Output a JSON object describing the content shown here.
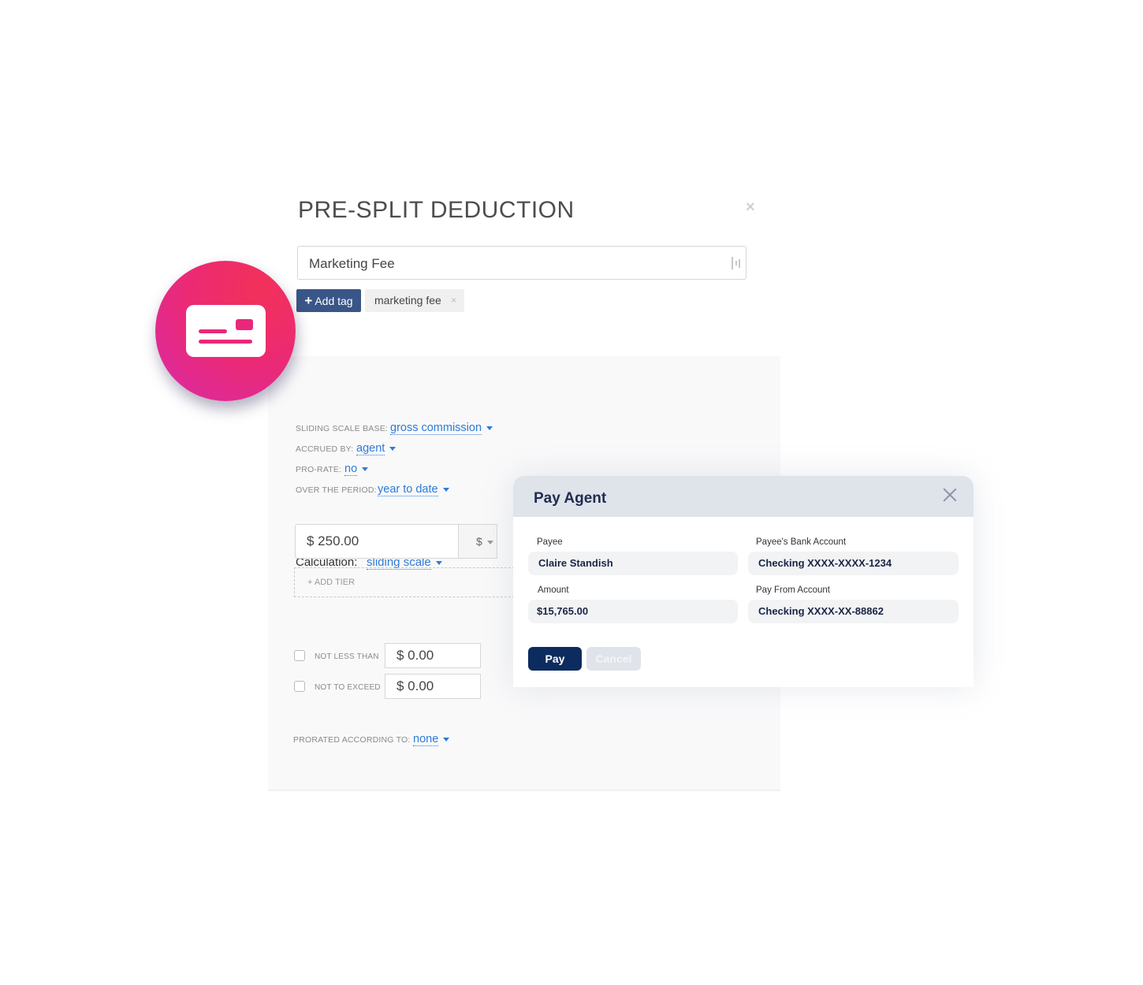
{
  "deduction": {
    "title": "PRE-SPLIT DEDUCTION",
    "close_glyph": "×",
    "name_value": "Marketing Fee",
    "add_tag_label": "Add tag",
    "add_tag_glyph": "+",
    "tag": "marketing fee",
    "tag_remove_glyph": "×",
    "calculation_label": "Calculation:",
    "calculation_value": "sliding scale",
    "options": [
      {
        "label": "SLIDING SCALE BASE:",
        "value": "gross commission"
      },
      {
        "label": "ACCRUED BY:",
        "value": "agent"
      },
      {
        "label": "PRO-RATE:",
        "value": "no"
      },
      {
        "label": "OVER THE PERIOD:",
        "value": "year to date"
      }
    ],
    "amount_value": "$ 250.00",
    "unit_value": "$",
    "add_tier_label": "+ ADD TIER",
    "not_less_than_label": "NOT LESS THAN",
    "not_less_than_value": "$ 0.00",
    "not_less_than_checked": false,
    "not_to_exceed_label": "NOT TO EXCEED",
    "not_to_exceed_value": "$ 0.00",
    "not_to_exceed_checked": false,
    "prorated_label": "PRORATED ACCORDING TO:",
    "prorated_value": "none"
  },
  "pay_agent": {
    "title": "Pay Agent",
    "payee_label": "Payee",
    "payee_value": "Claire Standish",
    "bank_label": "Payee's Bank Account",
    "bank_value": "Checking XXXX-XXXX-1234",
    "amount_label": "Amount",
    "amount_value": "$15,765.00",
    "pay_from_label": "Pay From Account",
    "pay_from_value": "Checking XXXX-XX-88862",
    "pay_button": "Pay",
    "cancel_button": "Cancel"
  },
  "icons": {
    "badge": "id-card-icon",
    "grip": "text-editor-grip-icon",
    "close": "close-icon",
    "caret": "caret-down-icon"
  },
  "colors": {
    "link_blue": "#2f7bd6",
    "tag_button": "#3a5587",
    "pay_button": "#0c2b5e",
    "badge_pink": "#ec2a72"
  }
}
